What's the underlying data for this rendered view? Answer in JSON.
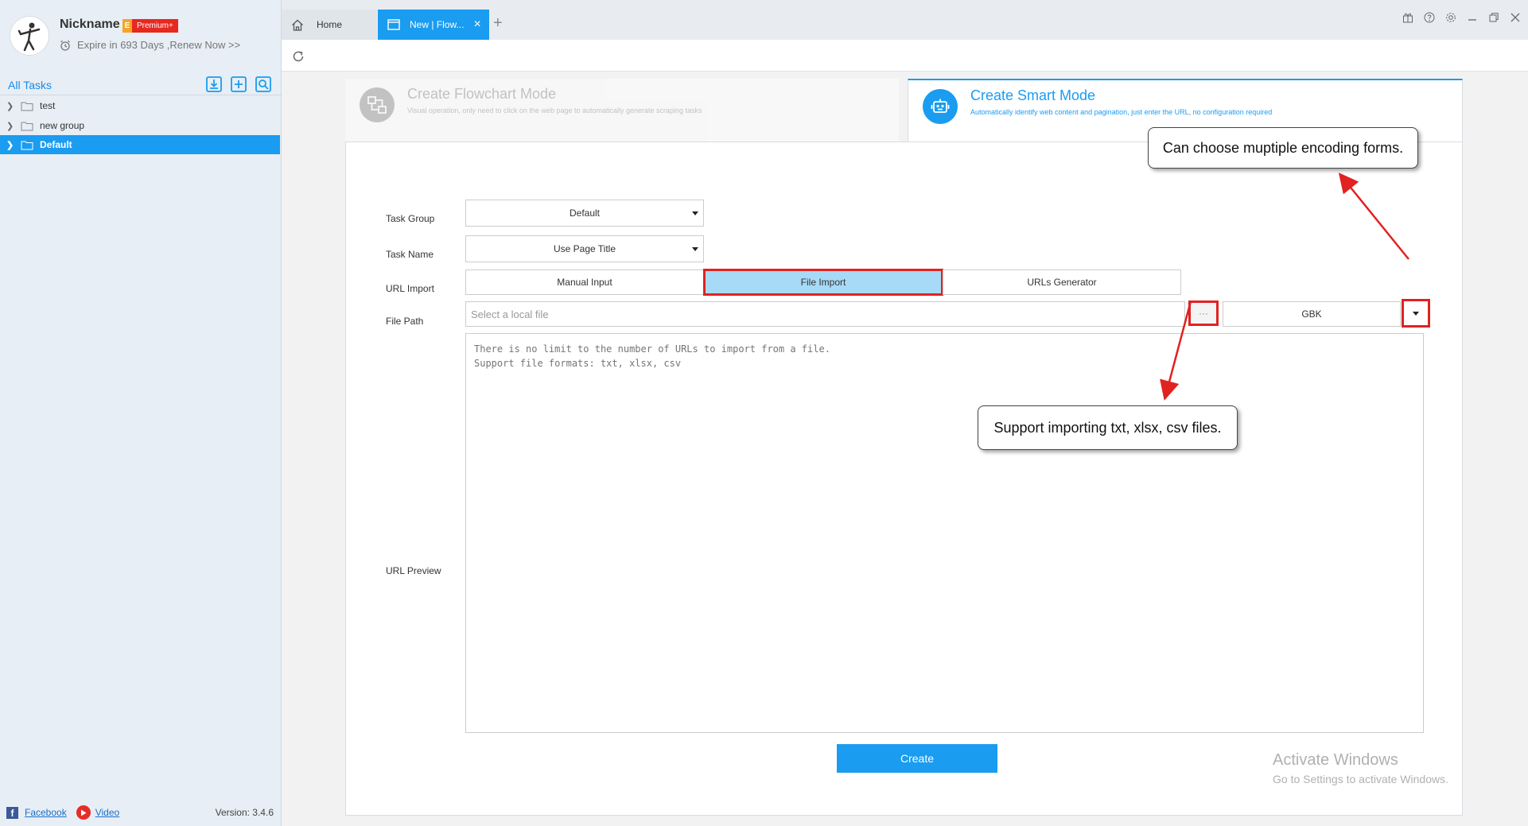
{
  "profile": {
    "nickname": "Nickname",
    "badge_e": "E",
    "badge_label": "Premium+",
    "expire_text": "Expire in 693 Days ,Renew Now >>"
  },
  "sidebar": {
    "all_tasks_label": "All Tasks",
    "tools": [
      "import-icon",
      "add-icon",
      "search-icon"
    ],
    "items": [
      {
        "label": "test",
        "selected": false
      },
      {
        "label": "new group",
        "selected": false
      },
      {
        "label": "Default",
        "selected": true
      }
    ],
    "footer": {
      "facebook_label": "Facebook",
      "video_label": "Video",
      "version": "Version: 3.4.6"
    }
  },
  "tabs": {
    "home_label": "Home",
    "new_label": "New | Flow...",
    "close_glyph": "×",
    "plus_glyph": "+"
  },
  "window_controls": [
    "gift-icon",
    "help-icon",
    "settings-icon",
    "minimize-icon",
    "restore-icon",
    "close-icon"
  ],
  "modes": {
    "flowchart": {
      "title": "Create Flowchart Mode",
      "desc": "Visual operation, only need to click on the web page to automatically generate scraping tasks"
    },
    "smart": {
      "title": "Create Smart Mode",
      "desc": "Automatically identify web content and pagination, just enter the URL, no configuration required"
    }
  },
  "form": {
    "task_group_label": "Task Group",
    "task_group_value": "Default",
    "task_name_label": "Task Name",
    "task_name_value": "Use Page Title",
    "url_import_label": "URL Import",
    "import_modes": [
      "Manual Input",
      "File Import",
      "URLs Generator"
    ],
    "active_import_mode": "File Import",
    "file_path_label": "File Path",
    "file_path_placeholder": "Select a local file",
    "browse_glyph": "···",
    "encoding_value": "GBK",
    "url_preview_label": "URL Preview",
    "preview_placeholder": "There is no limit to the number of URLs to import from a file.\nSupport file formats: txt, xlsx, csv",
    "create_label": "Create"
  },
  "callouts": {
    "encoding": "Can choose muptiple encoding forms.",
    "formats": "Support importing txt, xlsx, csv files."
  },
  "watermark": {
    "line1": "Activate Windows",
    "line2": "Go to Settings to activate Windows."
  },
  "colors": {
    "accent": "#1a9cf0",
    "highlight_red": "#e22121",
    "badge_red": "#e8281f",
    "active_segment": "#a7daf7"
  }
}
